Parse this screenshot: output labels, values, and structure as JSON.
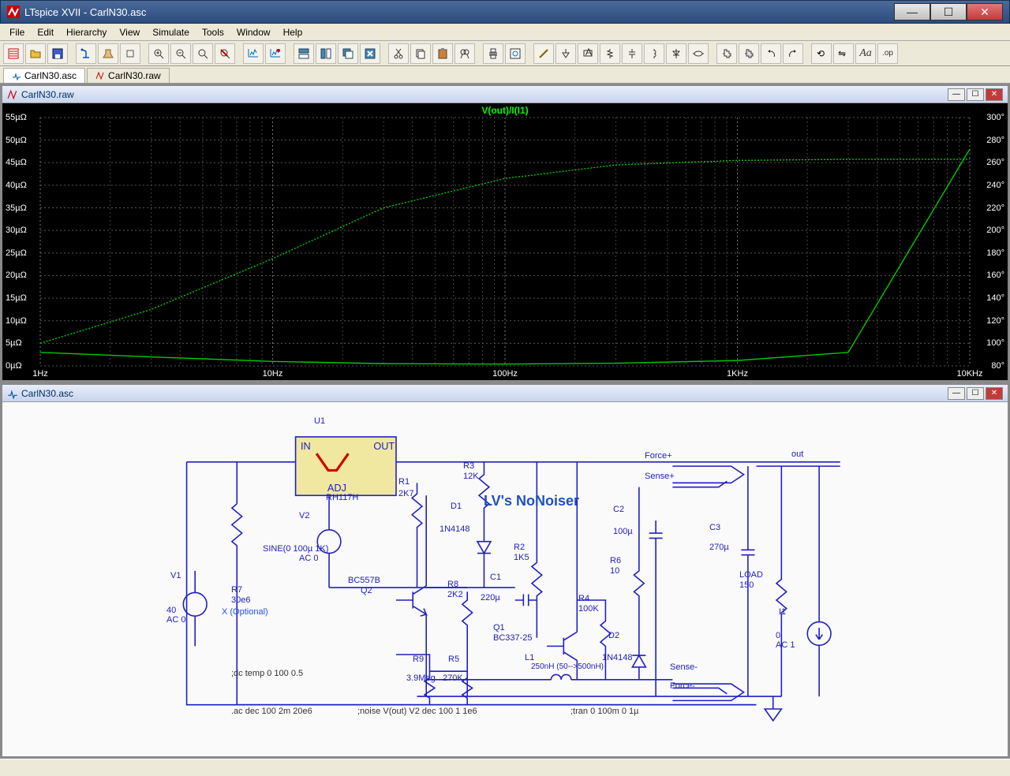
{
  "window": {
    "title": "LTspice XVII - CarlN30.asc",
    "min": "—",
    "max": "☐",
    "close": "✕"
  },
  "menu": [
    "File",
    "Edit",
    "Hierarchy",
    "View",
    "Simulate",
    "Tools",
    "Window",
    "Help"
  ],
  "tabs": [
    {
      "label": "CarlN30.asc",
      "active": true
    },
    {
      "label": "CarlN30.raw",
      "active": false
    }
  ],
  "mdi_plot": {
    "title": "CarlN30.raw",
    "trace": "V(out)/I(I1)"
  },
  "mdi_schem": {
    "title": "CarlN30.asc"
  },
  "chart_data": {
    "type": "line",
    "title": "V(out)/I(I1)",
    "xlabel": "",
    "x_scale": "log",
    "x_ticks": [
      "1Hz",
      "10Hz",
      "100Hz",
      "1KHz",
      "10KHz"
    ],
    "y1_label": "",
    "y1_ticks": [
      "0µΩ",
      "5µΩ",
      "10µΩ",
      "15µΩ",
      "20µΩ",
      "25µΩ",
      "30µΩ",
      "35µΩ",
      "40µΩ",
      "45µΩ",
      "50µΩ",
      "55µΩ"
    ],
    "y1_range": [
      0,
      55
    ],
    "y2_label": "",
    "y2_ticks": [
      "80°",
      "100°",
      "120°",
      "140°",
      "160°",
      "180°",
      "200°",
      "220°",
      "240°",
      "260°",
      "280°",
      "300°"
    ],
    "y2_range": [
      80,
      300
    ],
    "series": [
      {
        "name": "magnitude",
        "axis": "y1",
        "x": [
          1,
          3,
          10,
          30,
          100,
          300,
          1000,
          3000,
          10000
        ],
        "values": [
          3,
          2,
          1,
          0.5,
          0.4,
          0.6,
          1.2,
          3,
          48
        ]
      },
      {
        "name": "phase",
        "axis": "y2",
        "x": [
          1,
          3,
          10,
          30,
          100,
          300,
          1000,
          3000,
          10000
        ],
        "values": [
          100,
          130,
          175,
          220,
          246,
          258,
          262,
          263,
          263
        ]
      }
    ]
  },
  "schematic": {
    "title": "LV's NoNoiser",
    "chip": {
      "ref": "U1",
      "part": "RH117H",
      "pins": [
        "IN",
        "OUT",
        "ADJ"
      ]
    },
    "sources": {
      "V1": {
        "val": "40",
        "ac": "AC 0"
      },
      "V2": {
        "val": "SINE(0 100µ 1K)",
        "ac": "AC 0"
      },
      "I1": {
        "val": "0",
        "ac": "AC 1"
      }
    },
    "resistors": {
      "R1": "2K7",
      "R2": "1K5",
      "R3": "12K",
      "R4": "100K",
      "R5": "270K",
      "R6": "10",
      "R7": "30e6",
      "R8": "2K2",
      "R9": "3.9Meg",
      "LOAD": "150"
    },
    "caps": {
      "C1": "220µ",
      "C2": "100µ",
      "C3": "270µ"
    },
    "diodes": {
      "D1": "1N4148",
      "D2": "1N4148"
    },
    "bjts": {
      "Q1": "BC337-25",
      "Q2": "BC557B"
    },
    "inductor": {
      "L1": "250nH (50-->500nH)"
    },
    "nets": [
      "Force+",
      "Sense+",
      "Sense-",
      "Force-",
      "out"
    ],
    "note_r7": "X (Optional)",
    "directives": [
      ";dc temp 0 100 0.5",
      ".ac dec 100 2m 20e6",
      ";noise V(out) V2 dec 100 1 1e6",
      ";tran 0 100m 0 1µ"
    ]
  }
}
